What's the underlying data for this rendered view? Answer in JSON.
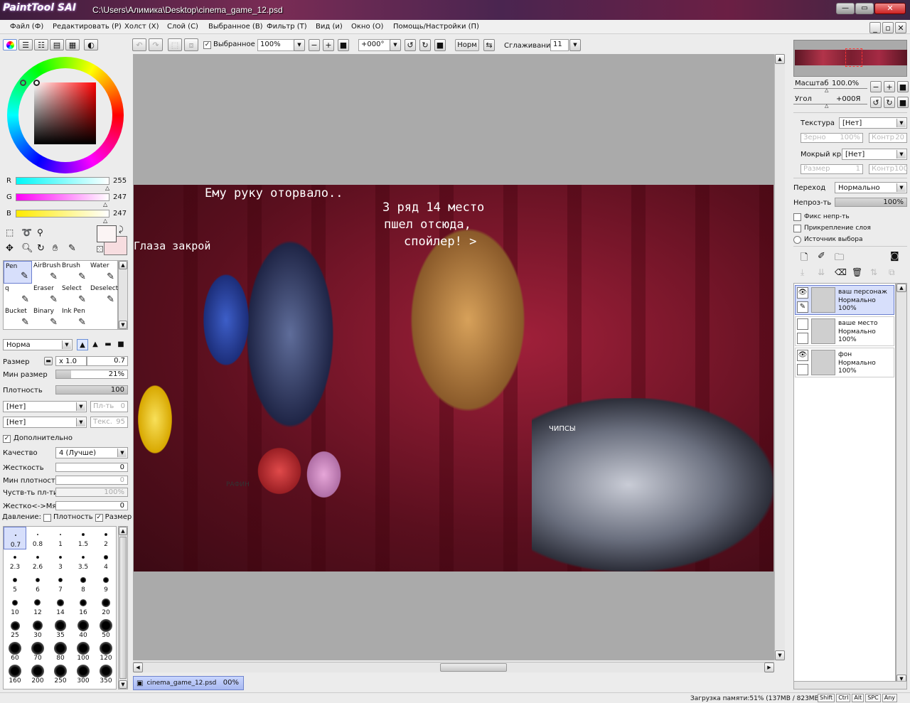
{
  "titlebar": {
    "app_logo": "PaintTool SAI",
    "path": "C:\\Users\\Алимика\\Desktop\\cinema_game_12.psd"
  },
  "menu": [
    "Файл (Ф)",
    "Редактировать (Р)",
    "Холст (Х)",
    "Слой (С)",
    "Выбранное (В)",
    "Фильтр (Т)",
    "Вид (и)",
    "Окно (О)",
    "Помощь/Настройки (П)"
  ],
  "toolbar": {
    "selection_label": "Выбранное",
    "zoom": "100%",
    "angle": "+000°",
    "norm_label": "Норм",
    "smoothing_label": "Сглаживание",
    "smoothing_value": "11"
  },
  "color": {
    "r_label": "R",
    "r": "255",
    "g_label": "G",
    "g": "247",
    "b_label": "B",
    "b": "247",
    "fg": "#fbf4f4",
    "bg": "#f7dde0"
  },
  "tools": [
    {
      "label": "Pen",
      "icon": "pen-icon",
      "sel": true
    },
    {
      "label": "AirBrush",
      "icon": "airbrush-icon"
    },
    {
      "label": "Brush",
      "icon": "brush-icon"
    },
    {
      "label": "Water",
      "icon": "water-icon"
    },
    {
      "label": "q",
      "icon": "pen-q-icon"
    },
    {
      "label": "Eraser",
      "icon": "eraser-icon"
    },
    {
      "label": "Select",
      "icon": "select-brush-icon"
    },
    {
      "label": "Deselect",
      "icon": "deselect-brush-icon"
    },
    {
      "label": "Bucket",
      "icon": "bucket-icon"
    },
    {
      "label": "Binary",
      "icon": "binary-pen-icon"
    },
    {
      "label": "Ink Pen",
      "icon": "ink-pen-icon"
    }
  ],
  "brush": {
    "mode": "Норма",
    "size_label": "Размер",
    "size_mult": "x 1.0",
    "size": "0.7",
    "min_size_label": "Мин размер",
    "min_size": "21%",
    "min_size_pct": 21,
    "density_label": "Плотность",
    "density": "100",
    "density_pct": 100,
    "paper": "[Нет]",
    "paper_amount_label": "Пл-ть",
    "paper_amount": "0",
    "texture": "[Нет]",
    "texture_amount_label": "Текс.",
    "texture_amount": "95",
    "advanced_label": "Дополнительно",
    "quality_label": "Качество",
    "quality": "4 (Лучше)",
    "hardness_label": "Жесткость",
    "hardness": "0",
    "min_density_label": "Мин плотность",
    "min_density": "0",
    "max_density_label": "Чуств-ть пл-ти",
    "max_density": "100%",
    "hard_soft_label": "Жестко<->Мягко",
    "hard_soft": "0",
    "pressure_label": "Давление:",
    "pressure_density_label": "Плотность",
    "pressure_size_label": "Размер"
  },
  "brush_sizes": [
    "0.7",
    "0.8",
    "1",
    "1.5",
    "2",
    "2.3",
    "2.6",
    "3",
    "3.5",
    "4",
    "5",
    "6",
    "7",
    "8",
    "9",
    "10",
    "12",
    "14",
    "16",
    "20",
    "25",
    "30",
    "35",
    "40",
    "50",
    "60",
    "70",
    "80",
    "100",
    "120",
    "160",
    "200",
    "250",
    "300",
    "350"
  ],
  "canvas": {
    "texts": [
      "Ему руку оторвало..",
      "Глаза закрой",
      "3 ряд 14 место",
      "пшел отсюда,",
      "спойлер! >",
      "ЧИПСЫ",
      "РАФИН"
    ]
  },
  "doc_tab": {
    "name": "cinema_game_12.psd",
    "percent": "00%"
  },
  "navigator": {
    "zoom_label": "Масштаб",
    "zoom": "100.0%",
    "angle_label": "Угол",
    "angle": "+000Я"
  },
  "layer_props": {
    "texture_label": "Текстура",
    "texture": "[Нет]",
    "grain_label": "Зерно",
    "grain": "100%",
    "contrast_label": "Контр",
    "contrast": "20",
    "wet_edge_label": "Мокрый край",
    "wet_edge": "[Нет]",
    "size_label": "Размер",
    "size": "1",
    "contrast2": "100",
    "blend_label": "Переход",
    "blend": "Нормально",
    "opacity_label": "Непроз-ть",
    "opacity": "100%",
    "opacity_pct": 100,
    "fix_opacity_label": "Фикс непр-ть",
    "clip_label": "Прикрепление слоя",
    "selection_source_label": "Источник выбора"
  },
  "layers": [
    {
      "name": "ваш персонаж",
      "mode": "Нормально",
      "opacity": "100%",
      "visible": true,
      "selected": true
    },
    {
      "name": "ваше место",
      "mode": "Нормально",
      "opacity": "100%",
      "visible": false,
      "selected": false
    },
    {
      "name": "фон",
      "mode": "Нормально",
      "opacity": "100%",
      "visible": true,
      "selected": false
    }
  ],
  "status": {
    "memory": "Загрузка памяти:51% (137MB / 823MB)",
    "keys": [
      "Shift",
      "Ctrl",
      "Alt",
      "SPC",
      "Any"
    ]
  }
}
